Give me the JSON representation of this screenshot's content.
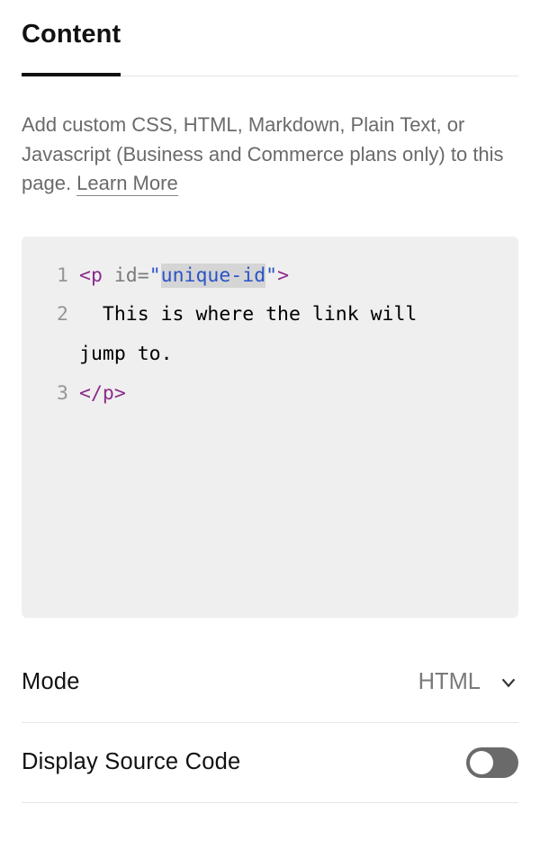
{
  "tabs": {
    "content": "Content"
  },
  "description": "Add custom CSS, HTML, Markdown, Plain Text, or Javascript (Business and Commerce plans only) to this page. ",
  "learn_more": "Learn More",
  "code": {
    "l1": {
      "num": "1",
      "open": "<p ",
      "attr": "id",
      "eq": "=",
      "q1": "\"",
      "val": "unique-id",
      "q2": "\"",
      "close": ">"
    },
    "l2": {
      "num": "2",
      "text": "  This is where the link will"
    },
    "l2b": {
      "text": "jump to."
    },
    "l3": {
      "num": "3",
      "text": "</p>"
    }
  },
  "mode": {
    "label": "Mode",
    "value": "HTML"
  },
  "display": {
    "label": "Display Source Code"
  }
}
